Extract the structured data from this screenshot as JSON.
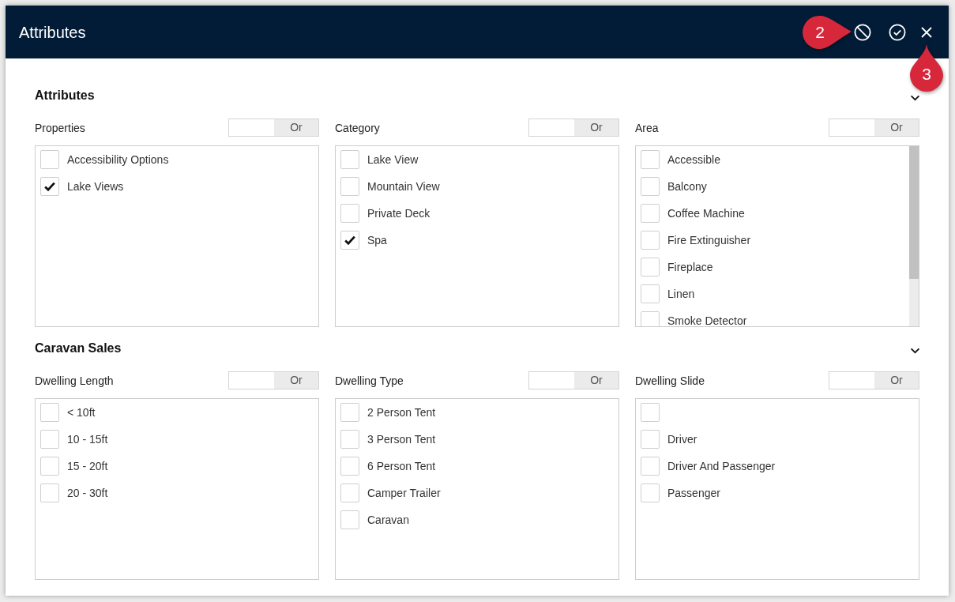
{
  "window": {
    "title": "Attributes"
  },
  "callouts": [
    {
      "number": "2",
      "kind": "right"
    },
    {
      "number": "3",
      "kind": "up"
    }
  ],
  "sections": [
    {
      "title": "Attributes",
      "expanded": true,
      "groups": [
        {
          "label": "Properties",
          "toggle": {
            "label": "Or"
          },
          "scrollable": false,
          "items": [
            {
              "label": "Accessibility Options",
              "checked": false
            },
            {
              "label": "Lake Views",
              "checked": true
            }
          ]
        },
        {
          "label": "Category",
          "toggle": {
            "label": "Or"
          },
          "scrollable": false,
          "items": [
            {
              "label": "Lake View",
              "checked": false
            },
            {
              "label": "Mountain View",
              "checked": false
            },
            {
              "label": "Private Deck",
              "checked": false
            },
            {
              "label": "Spa",
              "checked": true
            }
          ]
        },
        {
          "label": "Area",
          "toggle": {
            "label": "Or"
          },
          "scrollable": true,
          "items": [
            {
              "label": "Accessible",
              "checked": false
            },
            {
              "label": "Balcony",
              "checked": false
            },
            {
              "label": "Coffee Machine",
              "checked": false
            },
            {
              "label": "Fire Extinguisher",
              "checked": false
            },
            {
              "label": "Fireplace",
              "checked": false
            },
            {
              "label": "Linen",
              "checked": false
            },
            {
              "label": "Smoke Detector",
              "checked": false
            }
          ]
        }
      ]
    },
    {
      "title": "Caravan Sales",
      "expanded": true,
      "groups": [
        {
          "label": "Dwelling Length",
          "toggle": {
            "label": "Or"
          },
          "scrollable": false,
          "items": [
            {
              "label": "< 10ft",
              "checked": false
            },
            {
              "label": "10 - 15ft",
              "checked": false
            },
            {
              "label": "15 - 20ft",
              "checked": false
            },
            {
              "label": "20 - 30ft",
              "checked": false
            }
          ]
        },
        {
          "label": "Dwelling Type",
          "toggle": {
            "label": "Or"
          },
          "scrollable": false,
          "items": [
            {
              "label": "2 Person Tent",
              "checked": false
            },
            {
              "label": "3 Person Tent",
              "checked": false
            },
            {
              "label": "6 Person Tent",
              "checked": false
            },
            {
              "label": "Camper Trailer",
              "checked": false
            },
            {
              "label": "Caravan",
              "checked": false
            }
          ]
        },
        {
          "label": "Dwelling Slide",
          "toggle": {
            "label": "Or"
          },
          "scrollable": false,
          "items": [
            {
              "checked": false
            },
            {
              "label": "Driver",
              "checked": false
            },
            {
              "label": "Driver And Passenger",
              "checked": false
            },
            {
              "label": "Passenger",
              "checked": false
            }
          ]
        }
      ]
    }
  ]
}
